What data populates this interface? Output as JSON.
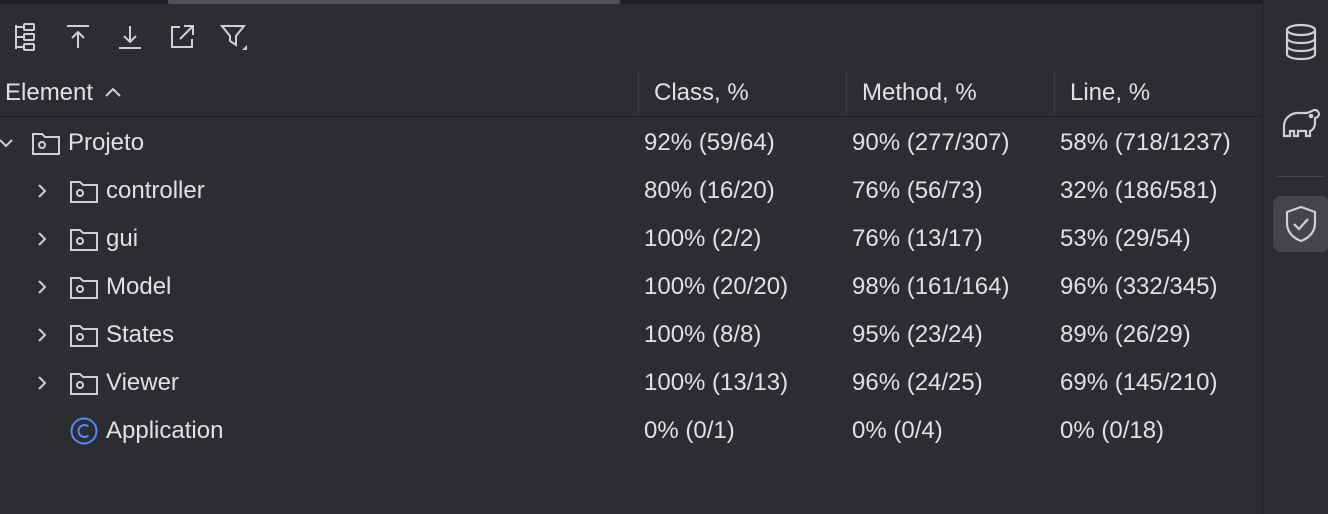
{
  "toolbar": {
    "icons": [
      "hierarchy-icon",
      "import-coverage-icon",
      "export-coverage-icon",
      "open-external-icon",
      "filter-icon"
    ]
  },
  "table": {
    "columns": [
      "Element",
      "Class, %",
      "Method, %",
      "Line, %"
    ],
    "rows": [
      {
        "name": "Projeto",
        "class": "92% (59/64)",
        "method": "90% (277/307)",
        "line": "58% (718/1237)"
      },
      {
        "name": "controller",
        "class": "80% (16/20)",
        "method": "76% (56/73)",
        "line": "32% (186/581)"
      },
      {
        "name": "gui",
        "class": "100% (2/2)",
        "method": "76% (13/17)",
        "line": "53% (29/54)"
      },
      {
        "name": "Model",
        "class": "100% (20/20)",
        "method": "98% (161/164)",
        "line": "96% (332/345)"
      },
      {
        "name": "States",
        "class": "100% (8/8)",
        "method": "95% (23/24)",
        "line": "89% (26/29)"
      },
      {
        "name": "Viewer",
        "class": "100% (13/13)",
        "method": "96% (24/25)",
        "line": "69% (145/210)"
      },
      {
        "name": "Application",
        "class": "0% (0/1)",
        "method": "0% (0/4)",
        "line": "0% (0/18)"
      }
    ]
  },
  "sidebar": {
    "icons": [
      "database-icon",
      "gradle-elephant-icon",
      "coverage-shield-icon"
    ]
  },
  "colors": {
    "background": "#2b2d30",
    "text": "#dfe1e5",
    "icon": "#ced0d6",
    "class_icon": "#548af7",
    "active_tool": "#43454a"
  }
}
